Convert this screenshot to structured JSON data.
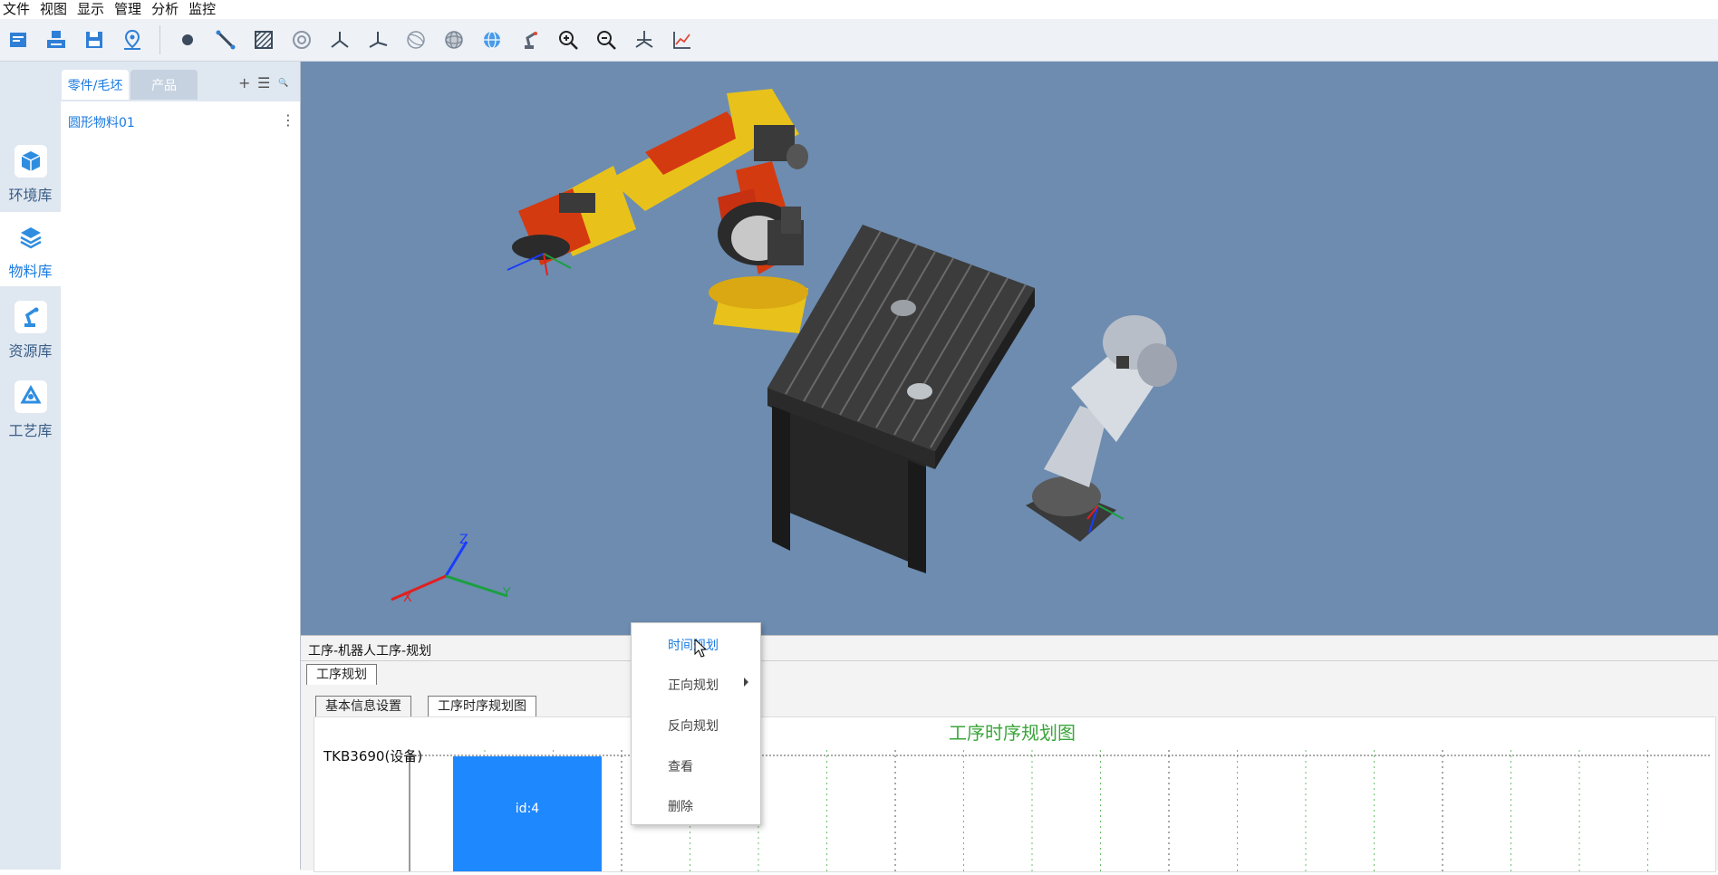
{
  "menubar": {
    "items": [
      "文件",
      "视图",
      "显示",
      "管理",
      "分析",
      "监控"
    ]
  },
  "toolbar": {
    "left_icons": [
      "open-icon",
      "print-icon",
      "save-icon",
      "location-icon"
    ],
    "right_icons": [
      "point-icon",
      "line-icon",
      "surface-icon",
      "circle-icon",
      "frame-icon",
      "axes-icon",
      "sphere-wire-icon",
      "sphere-icon",
      "globe-icon",
      "robot-icon",
      "zoom-in-icon",
      "zoom-out-icon",
      "coordinate-icon",
      "chart-icon"
    ]
  },
  "rail": {
    "items": [
      {
        "label": "环境库",
        "icon": "cube-icon"
      },
      {
        "label": "物料库",
        "icon": "layers-icon"
      },
      {
        "label": "资源库",
        "icon": "robot-arm-icon"
      },
      {
        "label": "工艺库",
        "icon": "recycle-icon"
      }
    ]
  },
  "library": {
    "tabs": [
      "零件/毛坯",
      "产品"
    ],
    "actions": [
      "+",
      "☰",
      "🔍"
    ],
    "rows": [
      "圆形物料01"
    ]
  },
  "viewport": {
    "axis_labels": {
      "x": "X",
      "y": "Y",
      "z": "Z"
    }
  },
  "bottom_panel": {
    "title": "工序-机器人工序-规划",
    "tab": "工序规划",
    "subtabs": [
      "基本信息设置",
      "工序时序规划图"
    ],
    "chart_title": "工序时序规划图"
  },
  "context_menu": {
    "items": [
      "时间规划",
      "正向规划",
      "反向规划",
      "查看",
      "删除"
    ]
  },
  "colors": {
    "accent": "#1a7ae0",
    "viewport_bg": "#6d8cb0",
    "chart_title": "#3aa53a",
    "bar": "#1e88ff",
    "rail_bg": "#dfe7f1"
  },
  "chart_data": {
    "type": "bar",
    "title": "工序时序规划图",
    "categories": [
      "TKB3690(设备)"
    ],
    "bars": [
      {
        "category": "TKB3690(设备)",
        "label": "id:4"
      }
    ]
  }
}
